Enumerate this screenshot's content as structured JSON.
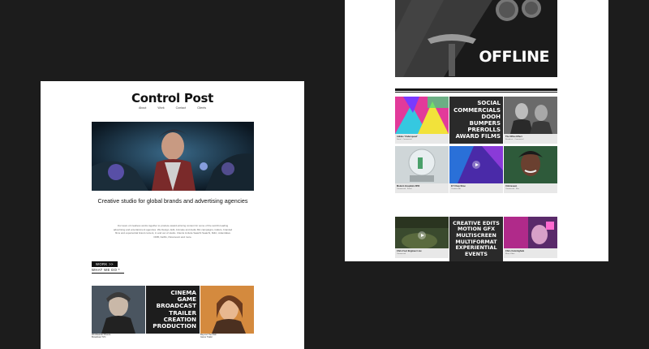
{
  "left_page": {
    "brand": "Control Post",
    "nav": [
      "About",
      "Work",
      "Contact",
      "Clients"
    ],
    "tagline": "Creative studio for global brands and advertising agencies",
    "description": "Our team of creatives works together to produce award-winning content for some of the world's leading advertising and entertainment agencies. We Design, Edit, Animate and Audio Mix campaigns, trailers, branded films and experiential brand content, in and out of studio. Clients include Saatchi Saatchi, M&C, Adam&Eve DDB, Netflix, Paramount and more.",
    "work_label": "WORK >>",
    "what_we_do_label": "WHAT WE DO *",
    "services_tile": [
      "CINEMA",
      "GAME",
      "BROADCAST",
      "TRAILER",
      "CREATION",
      "PRODUCTION"
    ],
    "tiles": [
      {
        "title": "Worldwarder Bravos",
        "subtitle": "Broadcast TVC"
      },
      {
        "title": "",
        "subtitle": ""
      },
      {
        "title": "Beyond The Rain",
        "subtitle": "Game Trailer"
      }
    ]
  },
  "right_page": {
    "offline_label": "OFFLINE",
    "services_tile": [
      "SOCIAL",
      "COMMERCIALS",
      "DOOH",
      "BUMPERS",
      "PREROLLS",
      "AWARD FILMS"
    ],
    "grid1": [
      {
        "title": "Adidas 'Underspeed'",
        "subtitle": "Social · Commercial"
      },
      {
        "title": "",
        "subtitle": ""
      },
      {
        "title": "The Office Effect",
        "subtitle": "Broadcast · Commercial"
      },
      {
        "title": "Modern Hospitals 2050",
        "subtitle": "Commercial · Social"
      },
      {
        "title": "EY Chop Shoe",
        "subtitle": "Creative edit"
      },
      {
        "title": "Unforeseen",
        "subtitle": "Commercial · Film"
      }
    ],
    "creative_tile": [
      "CREATIVE EDITS",
      "MOTION GFX",
      "MULTISCREEN",
      "MULTIFORMAT",
      "EXPERIENTIAL",
      "EVENTS"
    ],
    "grid2": [
      {
        "title": "Chris Foot Engineer Live",
        "subtitle": "Commercial"
      },
      {
        "title": "",
        "subtitle": ""
      },
      {
        "title": "Chris Cunningham",
        "subtitle": "Music Video"
      }
    ]
  },
  "colors": {
    "backdrop": "#1c1c1c",
    "page": "#ffffff",
    "ink": "#111111",
    "caption_bg": "#e8e8e8"
  }
}
